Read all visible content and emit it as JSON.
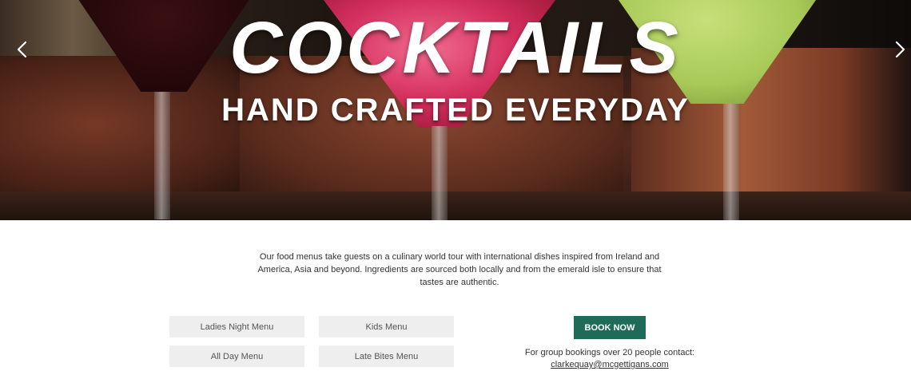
{
  "hero": {
    "title": "COCKTAILS",
    "subtitle": "HAND CRAFTED EVERYDAY",
    "prev_icon": "chevron-left-icon",
    "next_icon": "chevron-right-icon"
  },
  "intro": {
    "text": "Our food menus take guests on a culinary world tour with international dishes inspired from Ireland and America, Asia and beyond. Ingredients are sourced both locally and from the emerald isle to ensure that tastes are authentic."
  },
  "menus": [
    {
      "label": "Ladies Night Menu"
    },
    {
      "label": "Kids Menu"
    },
    {
      "label": "All Day Menu"
    },
    {
      "label": "Late Bites Menu"
    }
  ],
  "booking": {
    "button_label": "BOOK NOW",
    "group_note": "For group bookings over 20 people contact:",
    "email": "clarkequay@mcgettigans.com"
  },
  "colors": {
    "accent": "#1f6b57",
    "menu_button_bg": "#eeeeee"
  }
}
